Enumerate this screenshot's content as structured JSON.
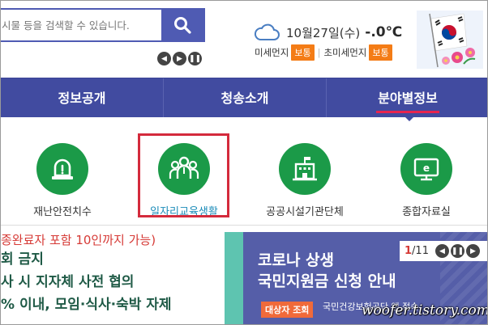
{
  "search": {
    "placeholder": "시물 등을 검색할 수 있습니다."
  },
  "weather": {
    "date": "10월27일(수)",
    "temperature": "-.0℃"
  },
  "dust": {
    "fine_label": "미세먼지",
    "fine_status": "보통",
    "ultrafine_label": "초미세먼지",
    "ultrafine_status": "보통",
    "status_color": "#f47c16"
  },
  "nav": {
    "items": [
      {
        "label": "정보공개"
      },
      {
        "label": "청송소개"
      },
      {
        "label": "분야별정보"
      }
    ],
    "active_color": "#e8244f",
    "bar_color": "#414ba0"
  },
  "categories": [
    {
      "label": "재난안전치수",
      "icon": "alarm-light-icon"
    },
    {
      "label": "일자리교육생활",
      "icon": "people-group-icon"
    },
    {
      "label": "공공시설기관단체",
      "icon": "public-building-icon"
    },
    {
      "label": "종합자료실",
      "icon": "e-monitor-icon"
    }
  ],
  "notice": {
    "lines": [
      "종완료자 포함 10인까지 가능)",
      "회 금지",
      "사 시 지자체 사전 협의",
      "% 이내, 모임·식사·숙박 자제"
    ]
  },
  "banner": {
    "title_line1": "코로나 상생",
    "title_line2": "국민지원금 신청 안내",
    "tag": "대상자 조회",
    "desc": "국민건강보험공단 앱 접속",
    "pager_current": "1",
    "pager_total": "/11"
  },
  "watermark": "woofer.tistory.com"
}
